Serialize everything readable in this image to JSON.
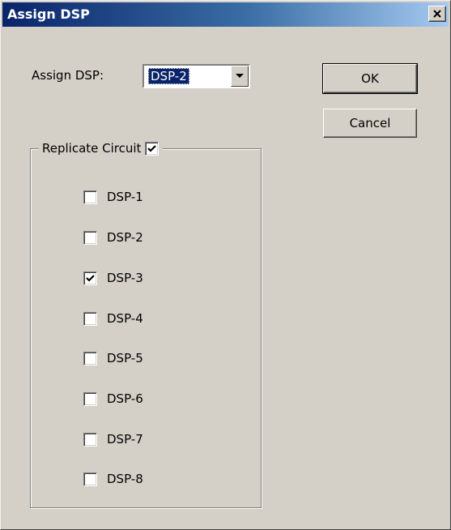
{
  "window": {
    "title": "Assign DSP",
    "close_glyph": "×"
  },
  "assign": {
    "label": "Assign DSP:",
    "selected": "DSP-2"
  },
  "buttons": {
    "ok": "OK",
    "cancel": "Cancel"
  },
  "replicate": {
    "label": "Replicate Circuit",
    "checked": true,
    "items": [
      {
        "label": "DSP-1",
        "checked": false
      },
      {
        "label": "DSP-2",
        "checked": false
      },
      {
        "label": "DSP-3",
        "checked": true
      },
      {
        "label": "DSP-4",
        "checked": false
      },
      {
        "label": "DSP-5",
        "checked": false
      },
      {
        "label": "DSP-6",
        "checked": false
      },
      {
        "label": "DSP-7",
        "checked": false
      },
      {
        "label": "DSP-8",
        "checked": false
      }
    ]
  },
  "colors": {
    "dialog_bg": "#d4d0c8",
    "titlebar_start": "#0a246a",
    "titlebar_end": "#a6caf0",
    "selection": "#0a246a"
  },
  "icons": {
    "close": "close-icon",
    "dropdown": "chevron-down-icon",
    "check": "checkmark-icon"
  }
}
